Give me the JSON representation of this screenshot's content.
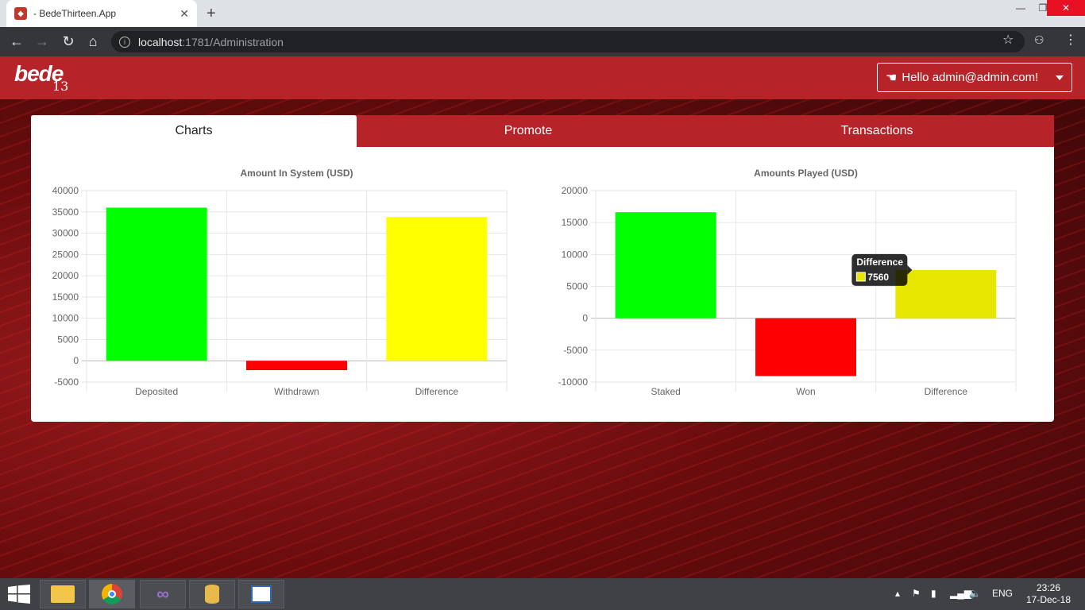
{
  "browser": {
    "tab_title": "- BedeThirteen.App",
    "url_host": "localhost",
    "url_path": ":1781/Administration"
  },
  "header": {
    "logo_text": "bede",
    "logo_number": "13",
    "user_greeting": "Hello admin@admin.com!"
  },
  "tabs": [
    {
      "label": "Charts"
    },
    {
      "label": "Promote"
    },
    {
      "label": "Transactions"
    }
  ],
  "chart_data": [
    {
      "type": "bar",
      "title": "Amount In System (USD)",
      "categories": [
        "Deposited",
        "Withdrawn",
        "Difference"
      ],
      "values": [
        36000,
        -2200,
        33800
      ],
      "colors": [
        "#00ff00",
        "#ff0000",
        "#ffff00"
      ],
      "ylim": [
        -5000,
        40000
      ],
      "yticks": [
        "40000",
        "35000",
        "30000",
        "25000",
        "20000",
        "15000",
        "10000",
        "5000",
        "0",
        "-5000"
      ],
      "grid": true
    },
    {
      "type": "bar",
      "title": "Amounts Played (USD)",
      "categories": [
        "Staked",
        "Won",
        "Difference"
      ],
      "values": [
        16620,
        -9060,
        7560
      ],
      "colors": [
        "#00ff00",
        "#ff0000",
        "#e6e600"
      ],
      "ylim": [
        -10000,
        20000
      ],
      "yticks": [
        "20000",
        "15000",
        "10000",
        "5000",
        "0",
        "-5000",
        "-10000"
      ],
      "grid": true,
      "tooltip": {
        "title": "Difference",
        "value": "7560"
      }
    }
  ],
  "taskbar": {
    "lang": "ENG",
    "time": "23:26",
    "date": "17-Dec-18"
  }
}
